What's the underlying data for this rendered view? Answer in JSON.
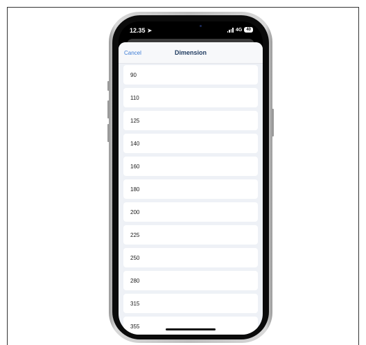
{
  "status_bar": {
    "time": "12.35",
    "network": "4G",
    "battery": "40"
  },
  "header": {
    "cancel_label": "Cancel",
    "title": "Dimension"
  },
  "options": [
    "90",
    "110",
    "125",
    "140",
    "160",
    "180",
    "200",
    "225",
    "250",
    "280",
    "315",
    "355"
  ],
  "colors": {
    "accent": "#3b7bd5",
    "title": "#1e3a5f",
    "sheet_background": "#eef1f6"
  }
}
